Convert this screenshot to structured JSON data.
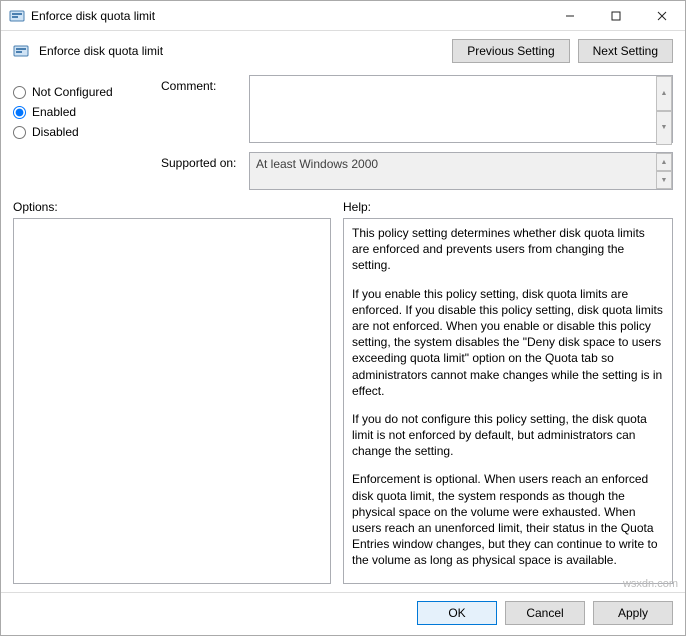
{
  "window": {
    "title": "Enforce disk quota limit"
  },
  "header": {
    "title": "Enforce disk quota limit",
    "previous_setting": "Previous Setting",
    "next_setting": "Next Setting"
  },
  "state": {
    "options": {
      "not_configured": "Not Configured",
      "enabled": "Enabled",
      "disabled": "Disabled"
    },
    "selected": "enabled"
  },
  "fields": {
    "comment_label": "Comment:",
    "comment_value": "",
    "supported_label": "Supported on:",
    "supported_value": "At least Windows 2000"
  },
  "section_labels": {
    "options": "Options:",
    "help": "Help:"
  },
  "help": {
    "p1": "This policy setting determines whether disk quota limits are enforced and prevents users from changing the setting.",
    "p2": "If you enable this policy setting, disk quota limits are enforced. If you disable this policy setting, disk quota limits are not enforced. When you enable or disable this policy setting, the system disables the \"Deny disk space to users exceeding quota limit\" option on the Quota tab so administrators cannot make changes while the setting is in effect.",
    "p3": "If you do not configure this policy setting, the disk quota limit is not enforced by default, but administrators can change the setting.",
    "p4": "Enforcement is optional. When users reach an enforced disk quota limit, the system responds as though the physical space on the volume were exhausted. When users reach an unenforced limit, their status in the Quota Entries window changes, but they can continue to write to the volume as long as physical space is available."
  },
  "footer": {
    "ok": "OK",
    "cancel": "Cancel",
    "apply": "Apply"
  },
  "watermark": "wsxdn.com"
}
